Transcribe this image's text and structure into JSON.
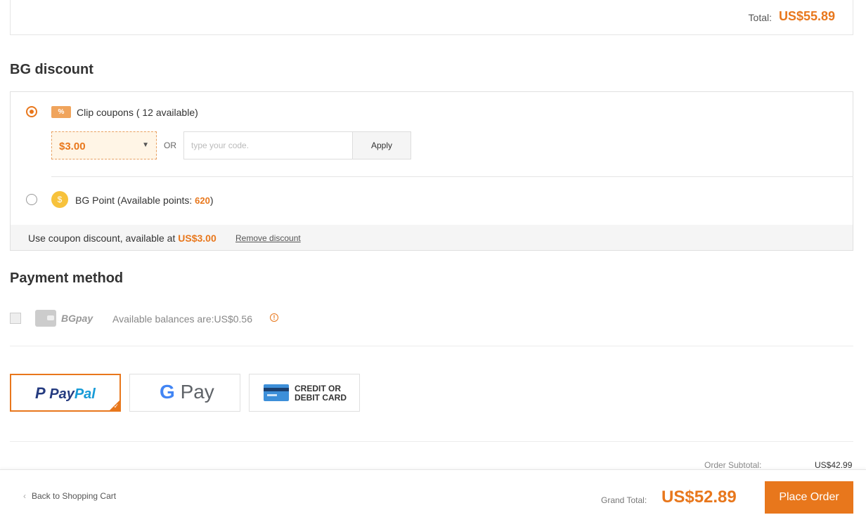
{
  "order_total": {
    "label": "Total:",
    "value": "US$55.89"
  },
  "bg_discount": {
    "title": "BG discount",
    "coupon": {
      "icon": "coupon-ticket-icon",
      "icon_text": "%",
      "label": "Clip coupons ( 12 available)",
      "selected_value": "$3.00",
      "or_text": "OR",
      "code_placeholder": "type your code.",
      "apply_label": "Apply"
    },
    "points": {
      "icon": "coin-icon",
      "icon_text": "$",
      "label_prefix": "BG Point (Available points: ",
      "value": "620",
      "label_suffix": ")"
    },
    "summary": {
      "text": "Use coupon discount, available at ",
      "amount": "US$3.00",
      "remove_label": "Remove discount"
    }
  },
  "payment": {
    "title": "Payment method",
    "bgpay": {
      "label": "BGpay",
      "balance_text": "Available balances are:US$0.56",
      "info_icon_text": "!"
    },
    "options": {
      "paypal": {
        "p": "P",
        "pay": "Pay",
        "pal": "Pal",
        "check": "✓"
      },
      "gpay": {
        "g": "G",
        "pay": "Pay"
      },
      "card": {
        "line1": "CREDIT OR",
        "line2": "DEBIT CARD"
      }
    }
  },
  "summary": {
    "subtotal_label": "Order Subtotal:",
    "subtotal_value": "US$42.99",
    "back_chevron": "‹",
    "back_label": "Back to Shopping Cart",
    "grand_total_label": "Grand Total:",
    "grand_total_value": "US$52.89",
    "place_order_label": "Place Order"
  },
  "colors": {
    "accent": "#e8771c",
    "paypal_dark": "#253b80",
    "paypal_light": "#179bd7"
  }
}
